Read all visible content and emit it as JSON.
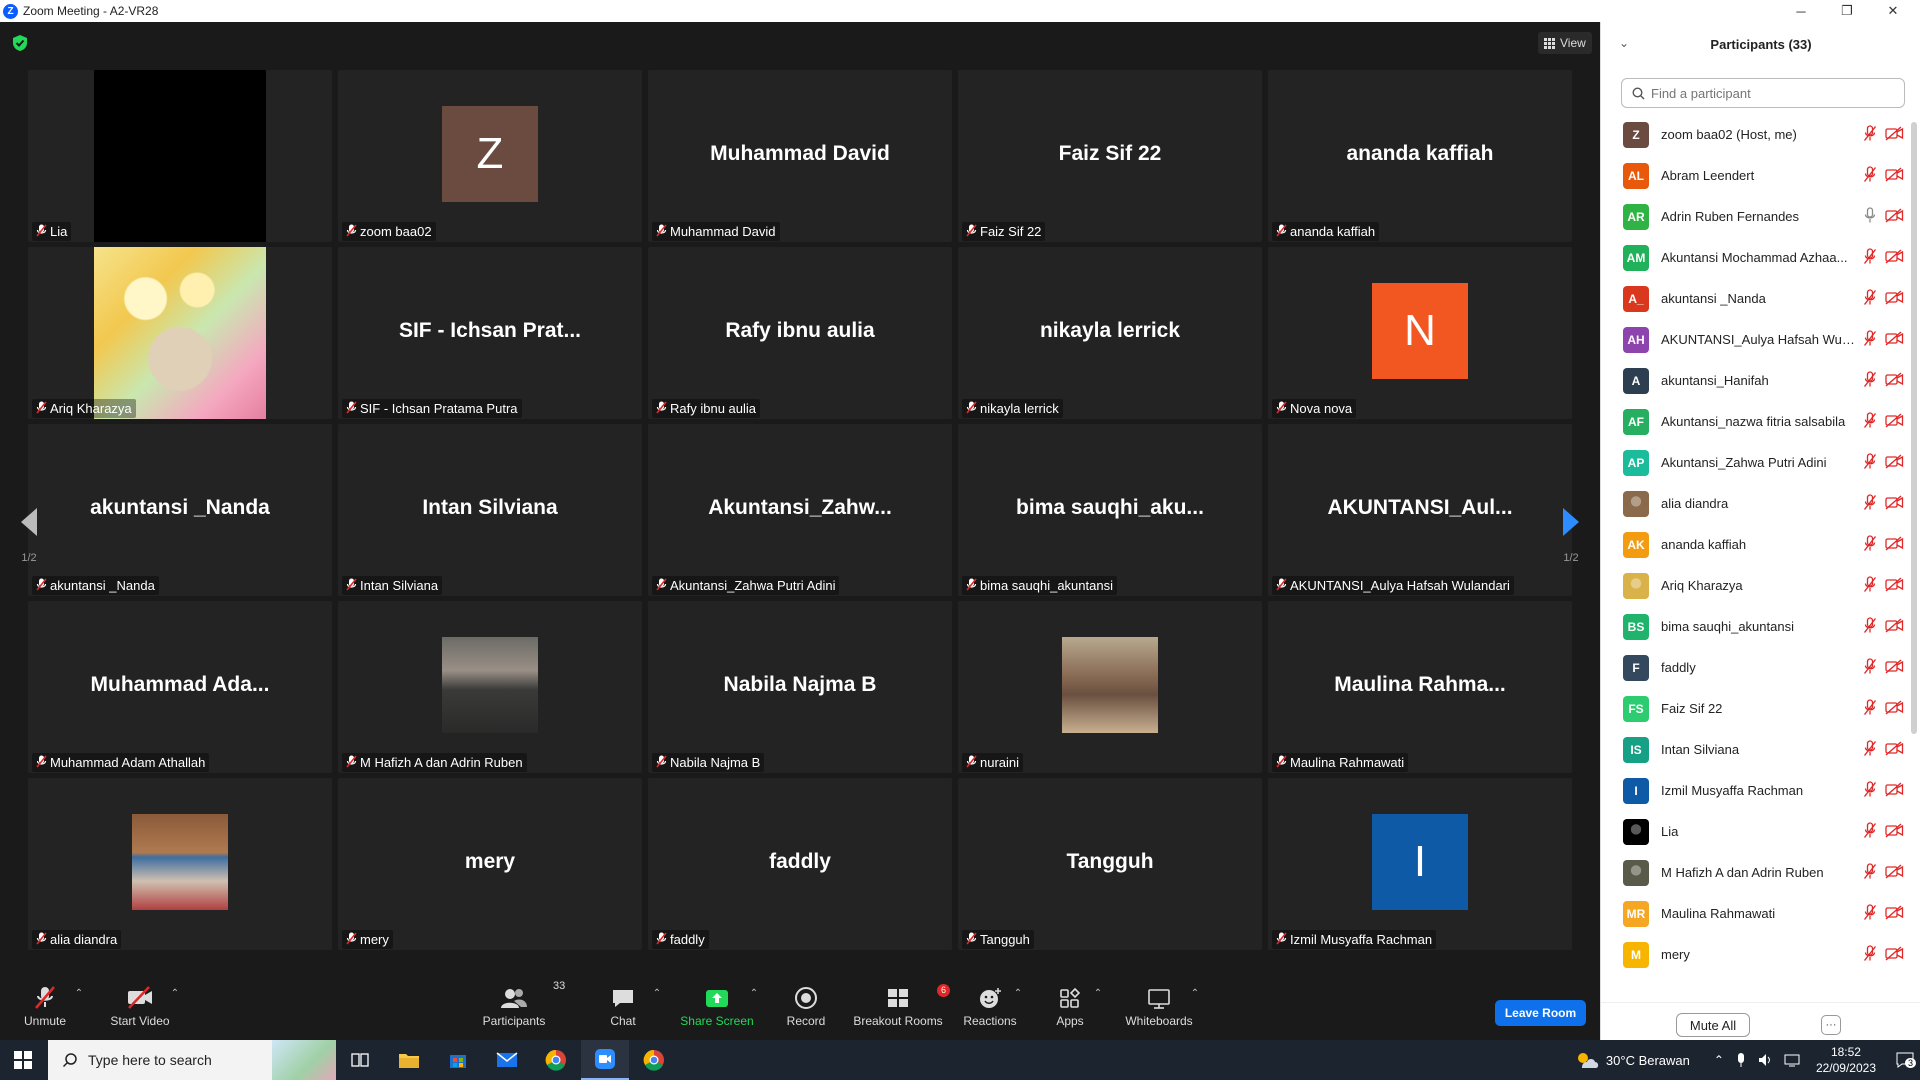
{
  "window": {
    "title": "Zoom Meeting - A2-VR28",
    "logo_letter": "Z",
    "minimize": "─",
    "maximize": "❐",
    "close": "✕"
  },
  "meeting": {
    "view_label": "View",
    "tiles": [
      {
        "big": "",
        "label": "Lia",
        "kind": "black"
      },
      {
        "big": "",
        "label": "zoom baa02",
        "kind": "avatar",
        "letter": "Z",
        "color": "#6b4a3f"
      },
      {
        "big": "Muhammad David",
        "label": "Muhammad David",
        "kind": "name"
      },
      {
        "big": "Faiz Sif 22",
        "label": "Faiz Sif 22",
        "kind": "name"
      },
      {
        "big": "ananda kaffiah",
        "label": "ananda kaffiah",
        "kind": "name"
      },
      {
        "big": "",
        "label": "Ariq Kharazya",
        "kind": "art"
      },
      {
        "big": "SIF - Ichsan Prat...",
        "label": "SIF - Ichsan Pratama Putra",
        "kind": "name"
      },
      {
        "big": "Rafy ibnu aulia",
        "label": "Rafy ibnu aulia",
        "kind": "name"
      },
      {
        "big": "nikayla lerrick",
        "label": "nikayla lerrick",
        "kind": "name"
      },
      {
        "big": "",
        "label": "Nova nova",
        "kind": "avatar",
        "letter": "N",
        "color": "#f25722"
      },
      {
        "big": "akuntansi _Nanda",
        "label": "akuntansi _Nanda",
        "kind": "name"
      },
      {
        "big": "Intan Silviana",
        "label": "Intan Silviana",
        "kind": "name"
      },
      {
        "big": "Akuntansi_Zahw...",
        "label": "Akuntansi_Zahwa Putri Adini",
        "kind": "name"
      },
      {
        "big": "bima  sauqhi_aku...",
        "label": "bima sauqhi_akuntansi",
        "kind": "name"
      },
      {
        "big": "AKUNTANSI_Aul...",
        "label": "AKUNTANSI_Aulya Hafsah Wulandari",
        "kind": "name"
      },
      {
        "big": "Muhammad  Ada...",
        "label": "Muhammad Adam Athallah",
        "kind": "name"
      },
      {
        "big": "",
        "label": "M Hafizh A dan Adrin Ruben",
        "kind": "photo1"
      },
      {
        "big": "Nabila Najma B",
        "label": "Nabila Najma B",
        "kind": "name"
      },
      {
        "big": "",
        "label": "nuraini",
        "kind": "photo2"
      },
      {
        "big": "Maulina  Rahma...",
        "label": "Maulina Rahmawati",
        "kind": "name"
      },
      {
        "big": "",
        "label": "alia diandra",
        "kind": "photo3"
      },
      {
        "big": "mery",
        "label": "mery",
        "kind": "name"
      },
      {
        "big": "faddly",
        "label": "faddly",
        "kind": "name"
      },
      {
        "big": "Tangguh",
        "label": "Tangguh",
        "kind": "name"
      },
      {
        "big": "",
        "label": "Izmil Musyaffa Rachman",
        "kind": "avatar",
        "letter": "I",
        "color": "#0e5aa7"
      }
    ],
    "page_left": "1/2",
    "page_right": "1/2"
  },
  "toolbar": {
    "unmute": "Unmute",
    "start_video": "Start Video",
    "participants": "Participants",
    "participants_count": "33",
    "chat": "Chat",
    "share_screen": "Share Screen",
    "record": "Record",
    "breakout_rooms": "Breakout Rooms",
    "breakout_badge": "6",
    "reactions": "Reactions",
    "apps": "Apps",
    "whiteboards": "Whiteboards",
    "leave": "Leave Room"
  },
  "panel": {
    "title": "Participants (33)",
    "search_placeholder": "Find a participant",
    "mute_all": "Mute All",
    "more": "···",
    "participants": [
      {
        "initials": "Z",
        "color": "#6b4a3f",
        "name": "zoom baa02 (Host, me)",
        "mic": "muted"
      },
      {
        "initials": "AL",
        "color": "#e8590c",
        "name": "Abram Leendert",
        "mic": "muted"
      },
      {
        "initials": "AR",
        "color": "#2fb344",
        "name": "Adrin Ruben Fernandes",
        "mic": "on"
      },
      {
        "initials": "AM",
        "color": "#20b15a",
        "name": "Akuntansi  Mochammad Azhaa...",
        "mic": "muted"
      },
      {
        "initials": "A_",
        "color": "#d9381e",
        "name": "akuntansi _Nanda",
        "mic": "muted"
      },
      {
        "initials": "AH",
        "color": "#8e44ad",
        "name": "AKUNTANSI_Aulya Hafsah Wula...",
        "mic": "muted"
      },
      {
        "initials": "A",
        "color": "#2c3e50",
        "name": "akuntansi_Hanifah",
        "mic": "muted"
      },
      {
        "initials": "AF",
        "color": "#27ae60",
        "name": "Akuntansi_nazwa fitria salsabila",
        "mic": "muted"
      },
      {
        "initials": "AP",
        "color": "#1abc9c",
        "name": "Akuntansi_Zahwa Putri Adini",
        "mic": "muted"
      },
      {
        "initials": "",
        "color": "#8a6a4a",
        "name": "alia diandra",
        "mic": "muted"
      },
      {
        "initials": "AK",
        "color": "#f39c12",
        "name": "ananda kaffiah",
        "mic": "muted"
      },
      {
        "initials": "",
        "color": "#d9b24a",
        "name": "Ariq Kharazya",
        "mic": "muted"
      },
      {
        "initials": "BS",
        "color": "#1fb36b",
        "name": "bima sauqhi_akuntansi",
        "mic": "muted"
      },
      {
        "initials": "F",
        "color": "#34495e",
        "name": "faddly",
        "mic": "muted"
      },
      {
        "initials": "FS",
        "color": "#2ecc71",
        "name": "Faiz Sif 22",
        "mic": "muted"
      },
      {
        "initials": "IS",
        "color": "#16a085",
        "name": "Intan Silviana",
        "mic": "muted"
      },
      {
        "initials": "I",
        "color": "#0e5aa7",
        "name": "Izmil Musyaffa Rachman",
        "mic": "muted"
      },
      {
        "initials": "",
        "color": "#000000",
        "name": "Lia",
        "mic": "muted"
      },
      {
        "initials": "",
        "color": "#5a5a4a",
        "name": "M Hafizh A dan Adrin Ruben",
        "mic": "muted"
      },
      {
        "initials": "MR",
        "color": "#f5a623",
        "name": "Maulina Rahmawati",
        "mic": "muted"
      },
      {
        "initials": "M",
        "color": "#f7b500",
        "name": "mery",
        "mic": "muted"
      }
    ]
  },
  "taskbar": {
    "search_placeholder": "Type here to search",
    "weather": "30°C  Berawan",
    "time": "18:52",
    "date": "22/09/2023",
    "notif_count": "3"
  }
}
